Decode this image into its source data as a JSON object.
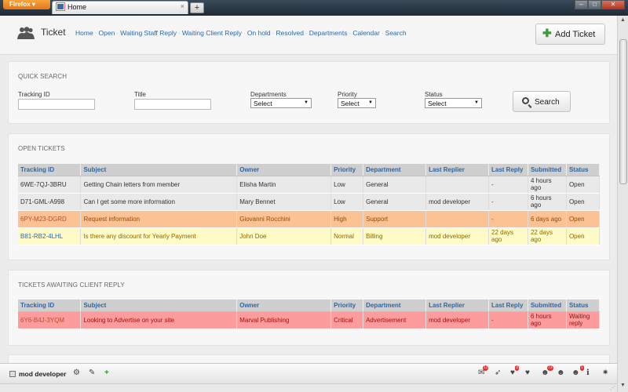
{
  "browser": {
    "menu_button": "Firefox",
    "tab_title": "Home",
    "new_tab": "+",
    "close_tab": "×"
  },
  "header": {
    "title": "Ticket",
    "nav": [
      "Home",
      "Open",
      "Waiting Staff Reply",
      "Waiting Client Reply",
      "On hold",
      "Resolved",
      "Departments",
      "Calendar",
      "Search"
    ],
    "add_button": "Add Ticket"
  },
  "quick_search": {
    "title": "QUICK SEARCH",
    "tracking_label": "Tracking ID",
    "title_label": "Title",
    "departments_label": "Departments",
    "departments_value": "Select",
    "priority_label": "Priority",
    "priority_value": "Select",
    "status_label": "Status",
    "status_value": "Select",
    "search_button": "Search"
  },
  "columns": [
    "Tracking ID",
    "Subject",
    "Owner",
    "Priority",
    "Department",
    "Last Replier",
    "Last Reply",
    "Submitted",
    "Status"
  ],
  "open_tickets": {
    "title": "OPEN TICKETS",
    "rows": [
      {
        "style": "gray",
        "tracking": "6WE-7QJ-3BRU",
        "subject": "Getting Chain letters from member",
        "owner": "Elisha Martin",
        "priority": "Low",
        "department": "General",
        "last_replier": "",
        "last_reply": "-",
        "submitted": "4 hours ago",
        "status": "Open"
      },
      {
        "style": "gray",
        "tracking": "D71-GML-A998",
        "subject": "Can I get some more information",
        "owner": "Mary Bennet",
        "priority": "Low",
        "department": "General",
        "last_replier": "mod developer",
        "last_reply": "-",
        "submitted": "6 hours ago",
        "status": "Open"
      },
      {
        "style": "orange",
        "tracking": "6PY-M23-DGRD",
        "subject": "Request information",
        "owner": "Giovanni Rocchini",
        "priority": "High",
        "department": "Support",
        "last_replier": "",
        "last_reply": "-",
        "submitted": "6 days ago",
        "status": "Open"
      },
      {
        "style": "yellow",
        "tracking": "B81-RB2-4LHL",
        "subject": "Is there any discount for Yearly Payment",
        "owner": "John Doe",
        "priority": "Normal",
        "department": "Billing",
        "last_replier": "mod developer",
        "last_reply": "22 days ago",
        "submitted": "22 days ago",
        "status": "Open"
      }
    ]
  },
  "awaiting_client": {
    "title": "TICKETS AWAITING CLIENT REPLY",
    "rows": [
      {
        "style": "red",
        "tracking": "6Y6-B4J-3YQM",
        "subject": "Looking to Advertise on your site",
        "owner": "Marval Publishing",
        "priority": "Critical",
        "department": "Advertisement",
        "last_replier": "mod developer",
        "last_reply": "-",
        "submitted": "6 hours ago",
        "status": "Waiting reply"
      }
    ]
  },
  "bottom_bar": {
    "user": "mod developer",
    "badges": {
      "mail": "11",
      "heart": "3",
      "users": "73",
      "user": "1"
    }
  },
  "icons": [
    "users-icon",
    "plus-icon",
    "search-icon",
    "gear-icon",
    "edit-icon",
    "add-icon",
    "mail-icon",
    "bird-icon",
    "heart-icon",
    "user-icon",
    "info-icon",
    "wrench-icon"
  ],
  "colors": {
    "link": "#2f66a4",
    "header_bg": "#cfcfcf",
    "row_gray": "#e9e9e9",
    "row_high": "#fcc294",
    "row_normal": "#fefbc6",
    "row_critical": "#fd9c9c",
    "add_plus": "#3a9a35"
  }
}
